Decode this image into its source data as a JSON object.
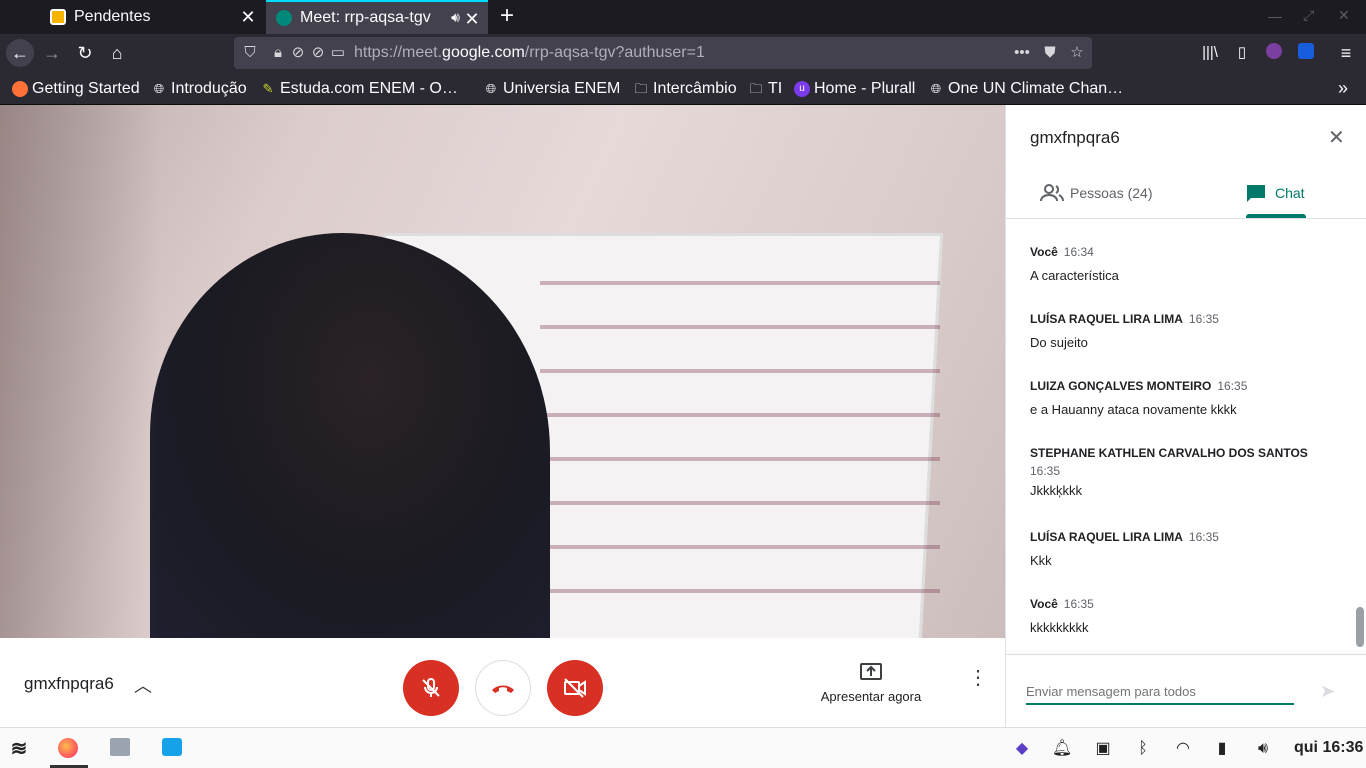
{
  "browser": {
    "tabs": [
      {
        "title": "Pendentes",
        "active": false
      },
      {
        "title": "Meet: rrp-aqsa-tgv",
        "active": true
      }
    ],
    "new_tab_label": "+",
    "url_prefix": "https://meet.",
    "url_domain": "google.com",
    "url_path": "/rrp-aqsa-tgv?authuser=1",
    "bookmarks": [
      "Getting Started",
      "Introdução",
      "Estuda.com ENEM - O…",
      "Universia ENEM",
      "Intercâmbio",
      "TI",
      "Home - Plurall",
      "One UN Climate Chan…"
    ],
    "accent_color": "#00ddff"
  },
  "meet": {
    "self_name": "gmxfnpqra6",
    "present_label": "Apresentar agora",
    "colors": {
      "danger": "#d93025",
      "accent": "#00796b"
    }
  },
  "panel": {
    "title": "gmxfnpqra6",
    "tab_people": "Pessoas (24)",
    "tab_chat": "Chat",
    "messages": [
      {
        "sender": "Você",
        "time": "16:34",
        "text": "A característica"
      },
      {
        "sender": "LUÍSA RAQUEL LIRA LIMA",
        "time": "16:35",
        "text": "Do sujeito"
      },
      {
        "sender": "LUIZA GONÇALVES MONTEIRO",
        "time": "16:35",
        "text": "e a Hauanny ataca novamente kkkk"
      },
      {
        "sender": "STEPHANE KATHLEN CARVALHO DOS SANTOS",
        "time": "16:35",
        "text": "Jkkkķkkk"
      },
      {
        "sender": "LUÍSA RAQUEL LIRA LIMA",
        "time": "16:35",
        "text": "Kkk"
      },
      {
        "sender": "Você",
        "time": "16:35",
        "text": "kkkkkkkkk"
      }
    ],
    "input_placeholder": "Enviar mensagem para todos"
  },
  "taskbar": {
    "clock": "qui 16:36"
  }
}
